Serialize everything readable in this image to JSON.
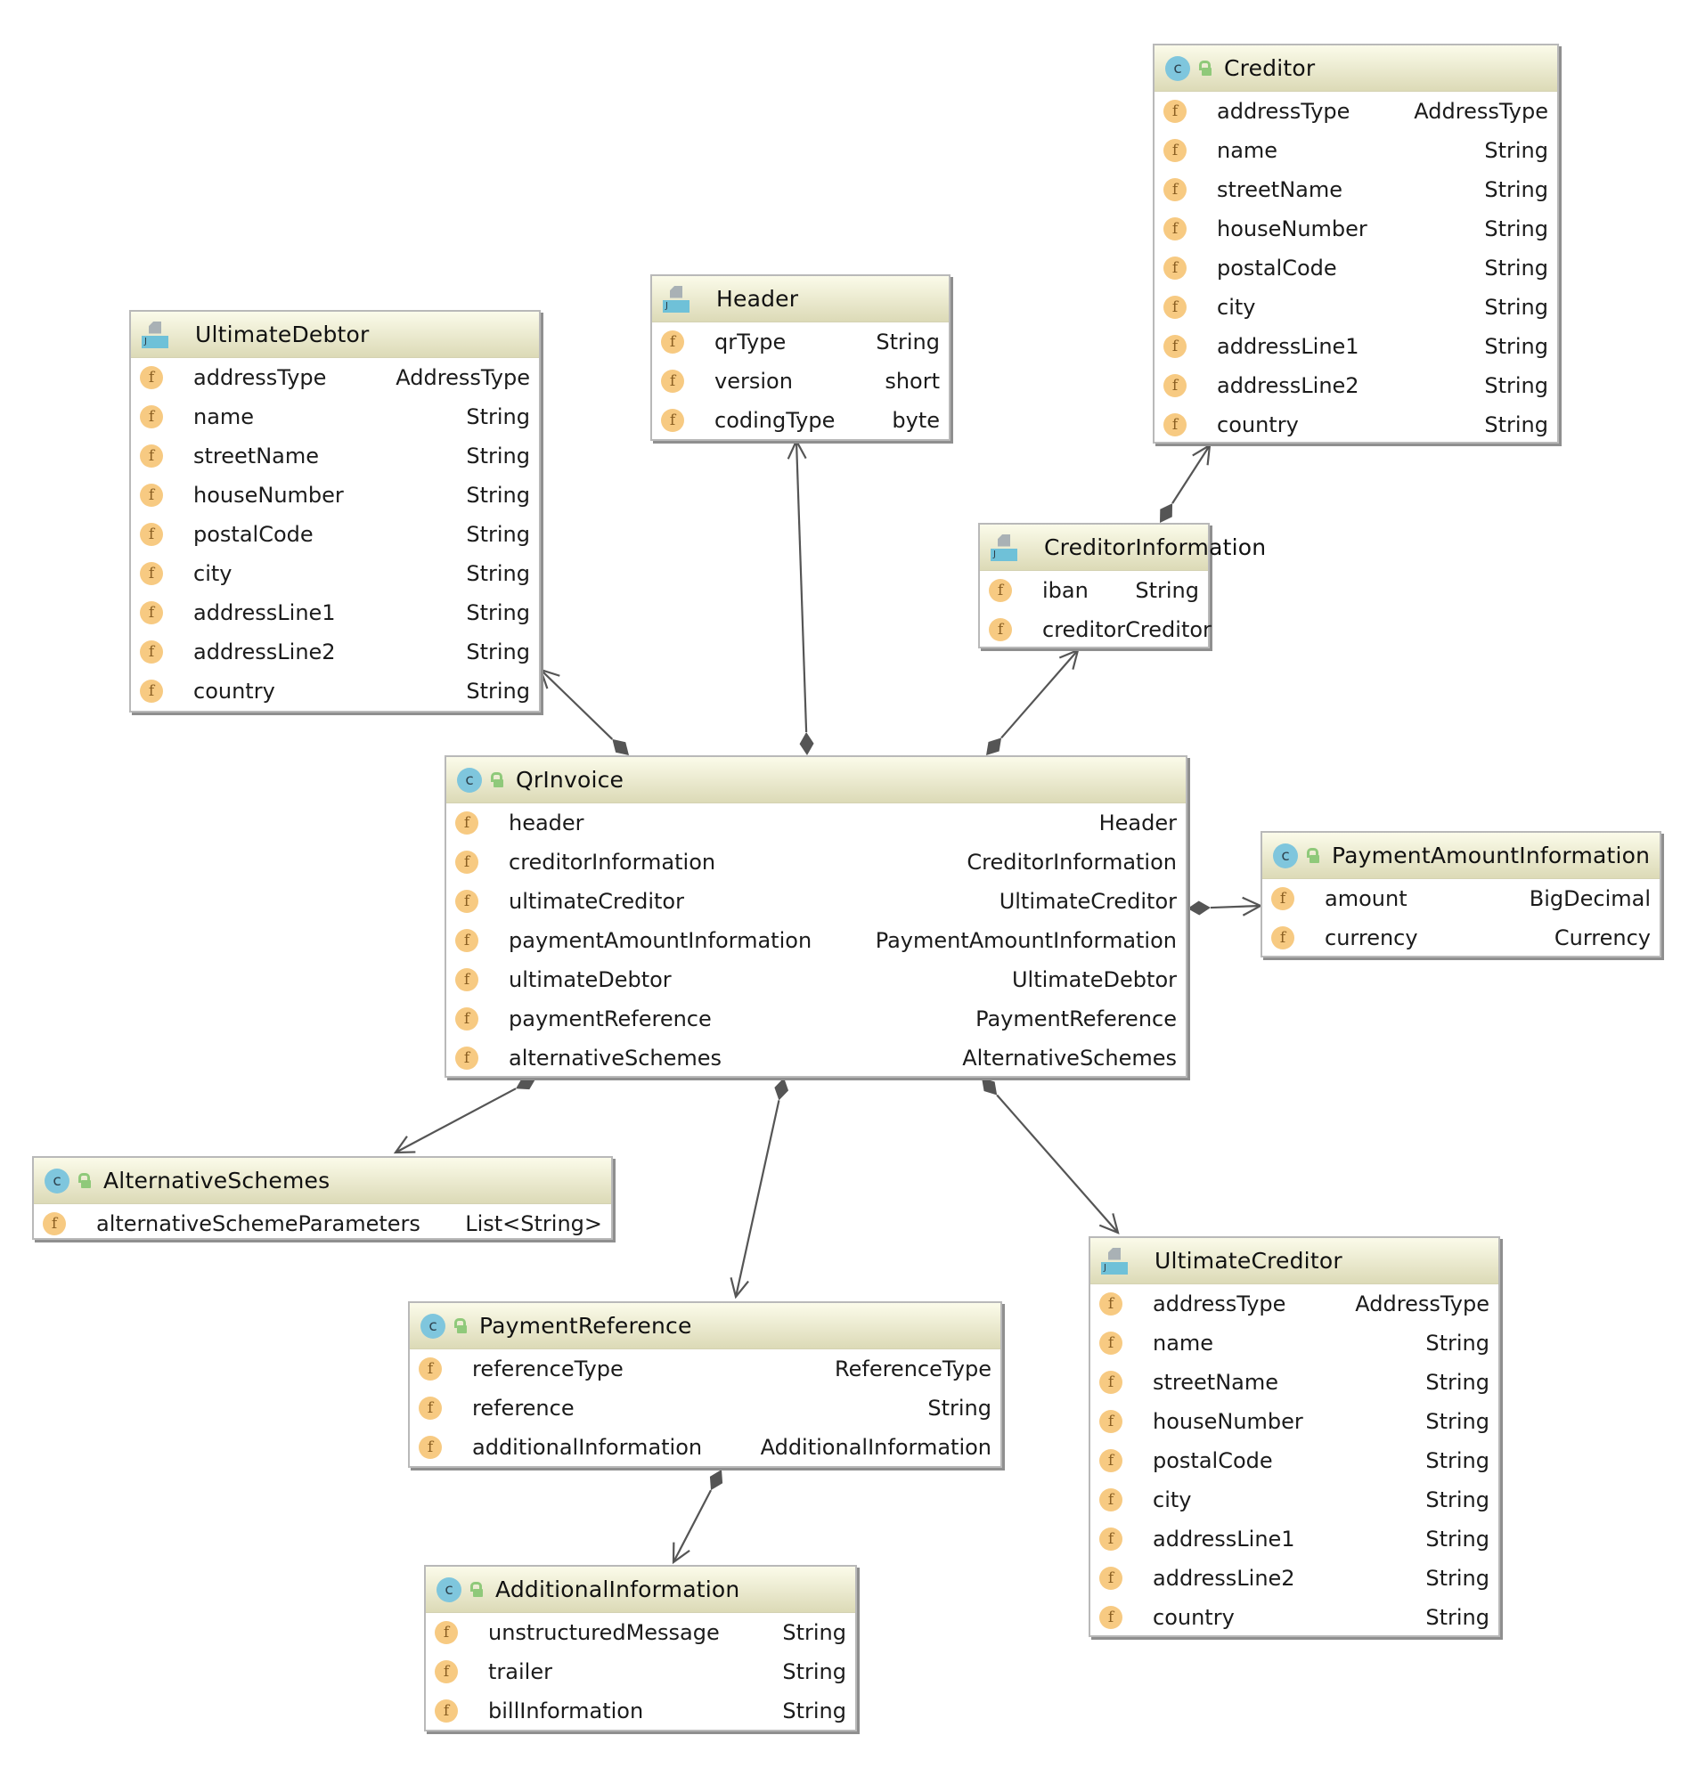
{
  "diagram": {
    "colors": {
      "header_top": "#fbfbea",
      "header_bottom": "#dcdab7",
      "class_icon": "#7fc6dd",
      "field_icon": "#f7ca82",
      "lock_icon": "#8fc97a",
      "edge": "#555555"
    },
    "icons": {
      "class": "c",
      "field": "f",
      "interface_letter": "J"
    },
    "nodes": {
      "creditor": {
        "kind": "class",
        "title": "Creditor",
        "fields": [
          {
            "name": "addressType",
            "type": "AddressType"
          },
          {
            "name": "name",
            "type": "String"
          },
          {
            "name": "streetName",
            "type": "String"
          },
          {
            "name": "houseNumber",
            "type": "String"
          },
          {
            "name": "postalCode",
            "type": "String"
          },
          {
            "name": "city",
            "type": "String"
          },
          {
            "name": "addressLine1",
            "type": "String"
          },
          {
            "name": "addressLine2",
            "type": "String"
          },
          {
            "name": "country",
            "type": "String"
          }
        ]
      },
      "header": {
        "kind": "interface",
        "title": "Header",
        "fields": [
          {
            "name": "qrType",
            "type": "String"
          },
          {
            "name": "version",
            "type": "short"
          },
          {
            "name": "codingType",
            "type": "byte"
          }
        ]
      },
      "ultimateDebtor": {
        "kind": "interface",
        "title": "UltimateDebtor",
        "fields": [
          {
            "name": "addressType",
            "type": "AddressType"
          },
          {
            "name": "name",
            "type": "String"
          },
          {
            "name": "streetName",
            "type": "String"
          },
          {
            "name": "houseNumber",
            "type": "String"
          },
          {
            "name": "postalCode",
            "type": "String"
          },
          {
            "name": "city",
            "type": "String"
          },
          {
            "name": "addressLine1",
            "type": "String"
          },
          {
            "name": "addressLine2",
            "type": "String"
          },
          {
            "name": "country",
            "type": "String"
          }
        ]
      },
      "creditorInformation": {
        "kind": "interface",
        "title": "CreditorInformation",
        "fields": [
          {
            "name": "iban",
            "type": "String"
          },
          {
            "name": "creditor",
            "type": "Creditor"
          }
        ]
      },
      "qrInvoice": {
        "kind": "class",
        "title": "QrInvoice",
        "fields": [
          {
            "name": "header",
            "type": "Header"
          },
          {
            "name": "creditorInformation",
            "type": "CreditorInformation"
          },
          {
            "name": "ultimateCreditor",
            "type": "UltimateCreditor"
          },
          {
            "name": "paymentAmountInformation",
            "type": "PaymentAmountInformation"
          },
          {
            "name": "ultimateDebtor",
            "type": "UltimateDebtor"
          },
          {
            "name": "paymentReference",
            "type": "PaymentReference"
          },
          {
            "name": "alternativeSchemes",
            "type": "AlternativeSchemes"
          }
        ]
      },
      "paymentAmountInformation": {
        "kind": "class",
        "title": "PaymentAmountInformation",
        "fields": [
          {
            "name": "amount",
            "type": "BigDecimal"
          },
          {
            "name": "currency",
            "type": "Currency"
          }
        ]
      },
      "alternativeSchemes": {
        "kind": "class",
        "title": "AlternativeSchemes",
        "fields": [
          {
            "name": "alternativeSchemeParameters",
            "type": "List<String>"
          }
        ]
      },
      "paymentReference": {
        "kind": "class",
        "title": "PaymentReference",
        "fields": [
          {
            "name": "referenceType",
            "type": "ReferenceType"
          },
          {
            "name": "reference",
            "type": "String"
          },
          {
            "name": "additionalInformation",
            "type": "AdditionalInformation"
          }
        ]
      },
      "ultimateCreditor": {
        "kind": "interface",
        "title": "UltimateCreditor",
        "fields": [
          {
            "name": "addressType",
            "type": "AddressType"
          },
          {
            "name": "name",
            "type": "String"
          },
          {
            "name": "streetName",
            "type": "String"
          },
          {
            "name": "houseNumber",
            "type": "String"
          },
          {
            "name": "postalCode",
            "type": "String"
          },
          {
            "name": "city",
            "type": "String"
          },
          {
            "name": "addressLine1",
            "type": "String"
          },
          {
            "name": "addressLine2",
            "type": "String"
          },
          {
            "name": "country",
            "type": "String"
          }
        ]
      },
      "additionalInformation": {
        "kind": "class",
        "title": "AdditionalInformation",
        "fields": [
          {
            "name": "unstructuredMessage",
            "type": "String"
          },
          {
            "name": "trailer",
            "type": "String"
          },
          {
            "name": "billInformation",
            "type": "String"
          }
        ]
      }
    },
    "edges": [
      {
        "from": "qrInvoice",
        "to": "header",
        "type": "composition"
      },
      {
        "from": "qrInvoice",
        "to": "creditorInformation",
        "type": "composition"
      },
      {
        "from": "qrInvoice",
        "to": "ultimateDebtor",
        "type": "composition"
      },
      {
        "from": "qrInvoice",
        "to": "paymentAmountInformation",
        "type": "composition"
      },
      {
        "from": "qrInvoice",
        "to": "alternativeSchemes",
        "type": "composition"
      },
      {
        "from": "qrInvoice",
        "to": "paymentReference",
        "type": "composition"
      },
      {
        "from": "qrInvoice",
        "to": "ultimateCreditor",
        "type": "composition"
      },
      {
        "from": "creditorInformation",
        "to": "creditor",
        "type": "composition"
      },
      {
        "from": "paymentReference",
        "to": "additionalInformation",
        "type": "composition"
      }
    ]
  }
}
